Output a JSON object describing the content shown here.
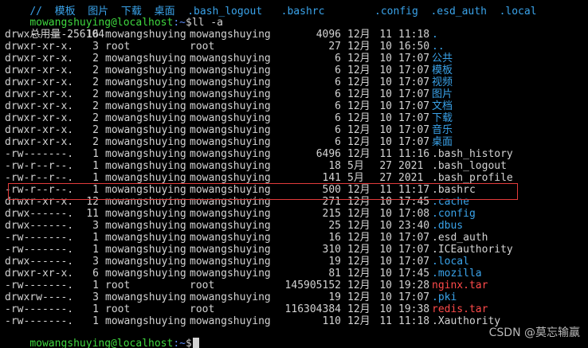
{
  "top_line": {
    "text": "//  模板  图片  下载  桌面  .bash_logout   .bashrc        .config  .esd_auth  .local"
  },
  "prompt": {
    "user_host": "mowangshuying@localhost",
    "path": ":~",
    "symbol": "$",
    "command": "ll -a"
  },
  "total": "总用量 256104",
  "entries": [
    {
      "perm": "drwx------.",
      "links": "16",
      "owner": "mowangshuying",
      "group": "mowangshuying",
      "size": "4096",
      "month": "12月",
      "day": "11",
      "time": "11:18",
      "name": ".",
      "type": "dir"
    },
    {
      "perm": "drwxr-xr-x.",
      "links": "3",
      "owner": "root",
      "group": "root",
      "size": "27",
      "month": "12月",
      "day": "10",
      "time": "16:50",
      "name": "..",
      "type": "dir"
    },
    {
      "perm": "drwxr-xr-x.",
      "links": "2",
      "owner": "mowangshuying",
      "group": "mowangshuying",
      "size": "6",
      "month": "12月",
      "day": "10",
      "time": "17:07",
      "name": "公共",
      "type": "dir"
    },
    {
      "perm": "drwxr-xr-x.",
      "links": "2",
      "owner": "mowangshuying",
      "group": "mowangshuying",
      "size": "6",
      "month": "12月",
      "day": "10",
      "time": "17:07",
      "name": "模板",
      "type": "dir"
    },
    {
      "perm": "drwxr-xr-x.",
      "links": "2",
      "owner": "mowangshuying",
      "group": "mowangshuying",
      "size": "6",
      "month": "12月",
      "day": "10",
      "time": "17:07",
      "name": "视频",
      "type": "dir"
    },
    {
      "perm": "drwxr-xr-x.",
      "links": "2",
      "owner": "mowangshuying",
      "group": "mowangshuying",
      "size": "6",
      "month": "12月",
      "day": "10",
      "time": "17:07",
      "name": "图片",
      "type": "dir"
    },
    {
      "perm": "drwxr-xr-x.",
      "links": "2",
      "owner": "mowangshuying",
      "group": "mowangshuying",
      "size": "6",
      "month": "12月",
      "day": "10",
      "time": "17:07",
      "name": "文档",
      "type": "dir"
    },
    {
      "perm": "drwxr-xr-x.",
      "links": "2",
      "owner": "mowangshuying",
      "group": "mowangshuying",
      "size": "6",
      "month": "12月",
      "day": "10",
      "time": "17:07",
      "name": "下载",
      "type": "dir"
    },
    {
      "perm": "drwxr-xr-x.",
      "links": "2",
      "owner": "mowangshuying",
      "group": "mowangshuying",
      "size": "6",
      "month": "12月",
      "day": "10",
      "time": "17:07",
      "name": "音乐",
      "type": "dir"
    },
    {
      "perm": "drwxr-xr-x.",
      "links": "2",
      "owner": "mowangshuying",
      "group": "mowangshuying",
      "size": "6",
      "month": "12月",
      "day": "10",
      "time": "17:07",
      "name": "桌面",
      "type": "dir"
    },
    {
      "perm": "-rw-------.",
      "links": "1",
      "owner": "mowangshuying",
      "group": "mowangshuying",
      "size": "6496",
      "month": "12月",
      "day": "11",
      "time": "11:16",
      "name": ".bash_history",
      "type": "file"
    },
    {
      "perm": "-rw-r--r--.",
      "links": "1",
      "owner": "mowangshuying",
      "group": "mowangshuying",
      "size": "18",
      "month": "5月",
      "day": "27",
      "time": "2021",
      "name": ".bash_logout",
      "type": "file"
    },
    {
      "perm": "-rw-r--r--.",
      "links": "1",
      "owner": "mowangshuying",
      "group": "mowangshuying",
      "size": "141",
      "month": "5月",
      "day": "27",
      "time": "2021",
      "name": ".bash_profile",
      "type": "file"
    },
    {
      "perm": "-rw-r--r--.",
      "links": "1",
      "owner": "mowangshuying",
      "group": "mowangshuying",
      "size": "500",
      "month": "12月",
      "day": "11",
      "time": "11:17",
      "name": ".bashrc",
      "type": "file",
      "highlighted": true
    },
    {
      "perm": "drwxr-xr-x.",
      "links": "12",
      "owner": "mowangshuying",
      "group": "mowangshuying",
      "size": "271",
      "month": "12月",
      "day": "10",
      "time": "17:45",
      "name": ".cache",
      "type": "dir"
    },
    {
      "perm": "drwx------.",
      "links": "11",
      "owner": "mowangshuying",
      "group": "mowangshuying",
      "size": "215",
      "month": "12月",
      "day": "10",
      "time": "17:08",
      "name": ".config",
      "type": "dir"
    },
    {
      "perm": "drwx------.",
      "links": "3",
      "owner": "mowangshuying",
      "group": "mowangshuying",
      "size": "25",
      "month": "12月",
      "day": "10",
      "time": "23:40",
      "name": ".dbus",
      "type": "dir"
    },
    {
      "perm": "-rw-------.",
      "links": "1",
      "owner": "mowangshuying",
      "group": "mowangshuying",
      "size": "16",
      "month": "12月",
      "day": "10",
      "time": "17:07",
      "name": ".esd_auth",
      "type": "file"
    },
    {
      "perm": "-rw-------.",
      "links": "1",
      "owner": "mowangshuying",
      "group": "mowangshuying",
      "size": "310",
      "month": "12月",
      "day": "10",
      "time": "17:07",
      "name": ".ICEauthority",
      "type": "file"
    },
    {
      "perm": "drwx------.",
      "links": "3",
      "owner": "mowangshuying",
      "group": "mowangshuying",
      "size": "19",
      "month": "12月",
      "day": "10",
      "time": "17:07",
      "name": ".local",
      "type": "dir"
    },
    {
      "perm": "drwxr-xr-x.",
      "links": "6",
      "owner": "mowangshuying",
      "group": "mowangshuying",
      "size": "81",
      "month": "12月",
      "day": "10",
      "time": "17:45",
      "name": ".mozilla",
      "type": "dir"
    },
    {
      "perm": "-rw-------.",
      "links": "1",
      "owner": "root",
      "group": "root",
      "size": "145905152",
      "month": "12月",
      "day": "10",
      "time": "19:28",
      "name": "nginx.tar",
      "type": "archive"
    },
    {
      "perm": "drwxrw----.",
      "links": "3",
      "owner": "mowangshuying",
      "group": "mowangshuying",
      "size": "19",
      "month": "12月",
      "day": "10",
      "time": "17:07",
      "name": ".pki",
      "type": "dir"
    },
    {
      "perm": "-rw-------.",
      "links": "1",
      "owner": "root",
      "group": "root",
      "size": "116304384",
      "month": "12月",
      "day": "10",
      "time": "19:38",
      "name": "redis.tar",
      "type": "archive"
    },
    {
      "perm": "-rw-------.",
      "links": "1",
      "owner": "mowangshuying",
      "group": "mowangshuying",
      "size": "110",
      "month": "12月",
      "day": "11",
      "time": "11:18",
      "name": ".Xauthority",
      "type": "file"
    }
  ],
  "final_prompt": {
    "user_host": "mowangshuying@localhost",
    "path": ":~",
    "symbol": "$"
  },
  "watermark": "CSDN @莫忘输赢",
  "colors": {
    "background": "#000000",
    "text": "#d3d3d3",
    "prompt_user": "#3fd83f",
    "prompt_path": "#5b8cf7",
    "directory": "#3aa3ea",
    "archive": "#ff4a4a",
    "highlight_border": "#e23b3b"
  }
}
